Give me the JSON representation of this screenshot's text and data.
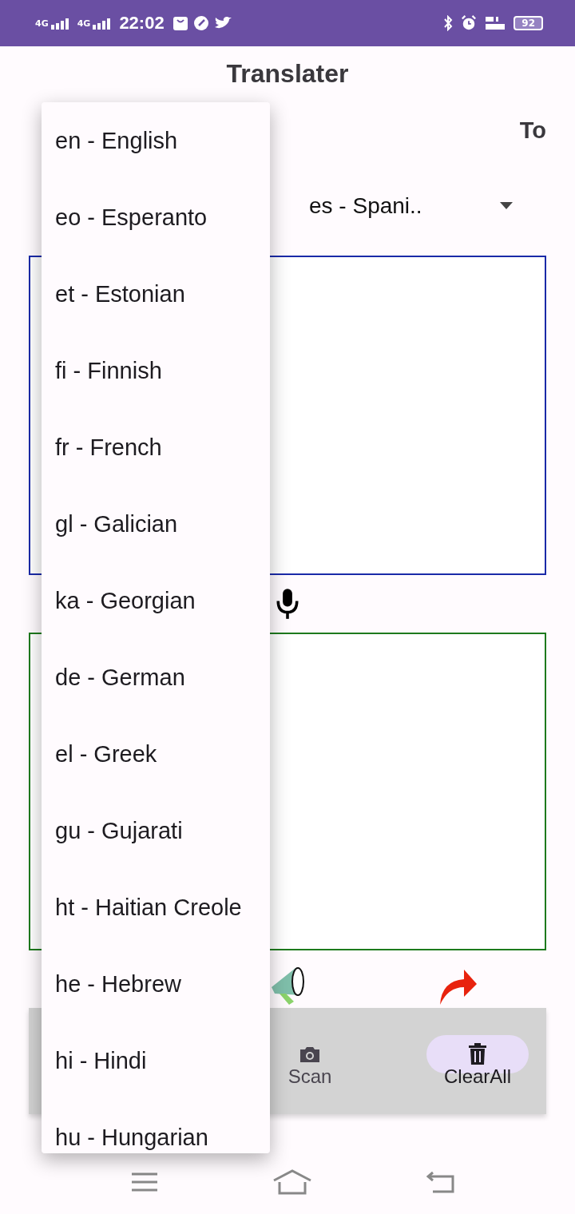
{
  "status_bar": {
    "networks": [
      "4G",
      "4G"
    ],
    "time": "22:02",
    "battery": "92"
  },
  "app_bar": {
    "title": "Translater"
  },
  "to_label": "To",
  "target_language": {
    "value": "es - Spani.."
  },
  "bottom_nav": [
    {
      "label": "Scan",
      "kind": "camera",
      "selected": false
    },
    {
      "label": "ClearAll",
      "kind": "trash",
      "selected": true
    }
  ],
  "dropdown": {
    "items": [
      "en - English",
      "eo - Esperanto",
      "et - Estonian",
      "fi - Finnish",
      "fr - French",
      "gl - Galician",
      "ka - Georgian",
      "de - German",
      "el - Greek",
      "gu - Gujarati",
      "ht - Haitian Creole",
      "he - Hebrew",
      "hi - Hindi",
      "hu - Hungarian"
    ]
  }
}
